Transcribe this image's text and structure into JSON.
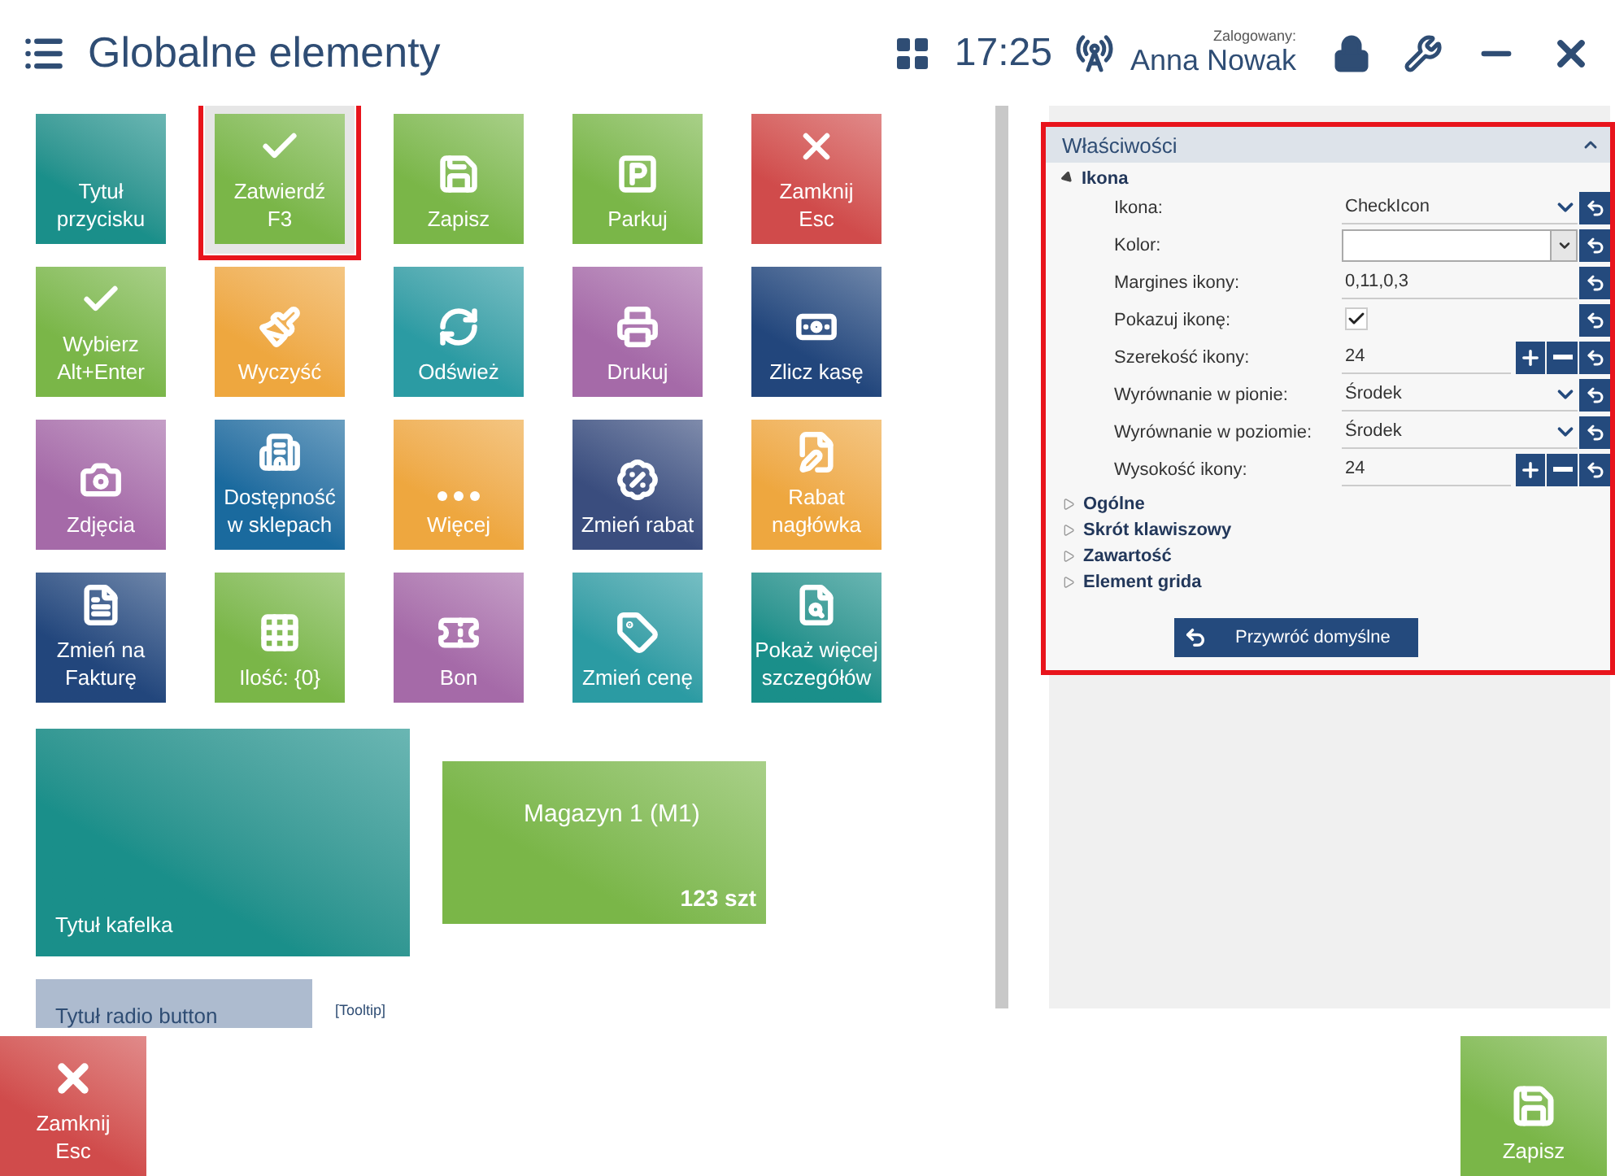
{
  "header": {
    "title": "Globalne elementy",
    "time": "17:25",
    "login_caption": "Zalogowany:",
    "user": "Anna Nowak"
  },
  "tiles": [
    {
      "label": "Tytuł\nprzycisku",
      "kind": "plain",
      "color": "#1a8f8a",
      "selected": false
    },
    {
      "label": "Zatwierdź\nF3",
      "kind": "check",
      "color": "#7ab648",
      "selected": true
    },
    {
      "label": "Zapisz",
      "kind": "save",
      "color": "#7ab648",
      "selected": false
    },
    {
      "label": "Parkuj",
      "kind": "parking",
      "color": "#7ab648",
      "selected": false
    },
    {
      "label": "Zamknij\nEsc",
      "kind": "close",
      "color": "#d04b4b",
      "selected": false
    },
    {
      "label": "Wybierz\nAlt+Enter",
      "kind": "check",
      "color": "#7ab648",
      "selected": false
    },
    {
      "label": "Wyczyść",
      "kind": "brush",
      "color": "#eea73f",
      "selected": false
    },
    {
      "label": "Odśwież",
      "kind": "refresh",
      "color": "#2b9ba3",
      "selected": false
    },
    {
      "label": "Drukuj",
      "kind": "printer",
      "color": "#a56aa8",
      "selected": false
    },
    {
      "label": "Zlicz kasę",
      "kind": "money",
      "color": "#22467c",
      "selected": false
    },
    {
      "label": "Zdjęcia",
      "kind": "camera",
      "color": "#a56aa8",
      "selected": false
    },
    {
      "label": "Dostępność\nw sklepach",
      "kind": "building",
      "color": "#1a6a9e",
      "selected": false
    },
    {
      "label": "Więcej",
      "kind": "more",
      "color": "#eea73f",
      "selected": false
    },
    {
      "label": "Zmień rabat",
      "kind": "percent",
      "color": "#3a4d7e",
      "selected": false
    },
    {
      "label": "Rabat\nnagłówka",
      "kind": "edit",
      "color": "#eea73f",
      "selected": false
    },
    {
      "label": "Zmień na\nFakturę",
      "kind": "document",
      "color": "#22467c",
      "selected": false
    },
    {
      "label": "Ilość: {0}",
      "kind": "grid",
      "color": "#7ab648",
      "selected": false
    },
    {
      "label": "Bon",
      "kind": "voucher",
      "color": "#a56aa8",
      "selected": false
    },
    {
      "label": "Zmień cenę",
      "kind": "tag",
      "color": "#2b9ba3",
      "selected": false
    },
    {
      "label": "Pokaż więcej\nszczegółów",
      "kind": "search",
      "color": "#1a8f8a",
      "selected": false
    }
  ],
  "large_tile": {
    "label": "Tytuł kafelka",
    "color": "#1a8f8a"
  },
  "stock_tile": {
    "title": "Magazyn 1 (M1)",
    "quantity": "123 szt",
    "color": "#7ab648"
  },
  "radio_tile": {
    "label": "Tytuł radio button",
    "tooltip": "[Tooltip]"
  },
  "properties": {
    "title": "Właściwości",
    "highlighted": true,
    "expanded": true,
    "sections": [
      {
        "title": "Ikona",
        "expanded": true,
        "rows": [
          {
            "kind": "dropdown",
            "label": "Ikona:",
            "value": "CheckIcon"
          },
          {
            "kind": "color",
            "label": "Kolor:"
          },
          {
            "kind": "text",
            "label": "Margines ikony:",
            "value": "0,11,0,3"
          },
          {
            "kind": "checkbox",
            "label": "Pokazuj ikonę:",
            "checked": true
          },
          {
            "kind": "number",
            "label": "Szerekość ikony:",
            "value": "24"
          },
          {
            "kind": "dropdown",
            "label": "Wyrównanie w pionie:",
            "value": "Środek"
          },
          {
            "kind": "dropdown",
            "label": "Wyrównanie w poziomie:",
            "value": "Środek"
          },
          {
            "kind": "number",
            "label": "Wysokość ikony:",
            "value": "24"
          }
        ]
      },
      {
        "title": "Ogólne",
        "expanded": false
      },
      {
        "title": "Skrót klawiszowy",
        "expanded": false
      },
      {
        "title": "Zawartość",
        "expanded": false
      },
      {
        "title": "Element grida",
        "expanded": false
      }
    ],
    "reset_button": "Przywróć domyślne"
  },
  "footer": {
    "close": {
      "label": "Zamknij\nEsc",
      "color": "#d04b4b"
    },
    "save": {
      "label": "Zapisz",
      "color": "#7ab648"
    }
  }
}
